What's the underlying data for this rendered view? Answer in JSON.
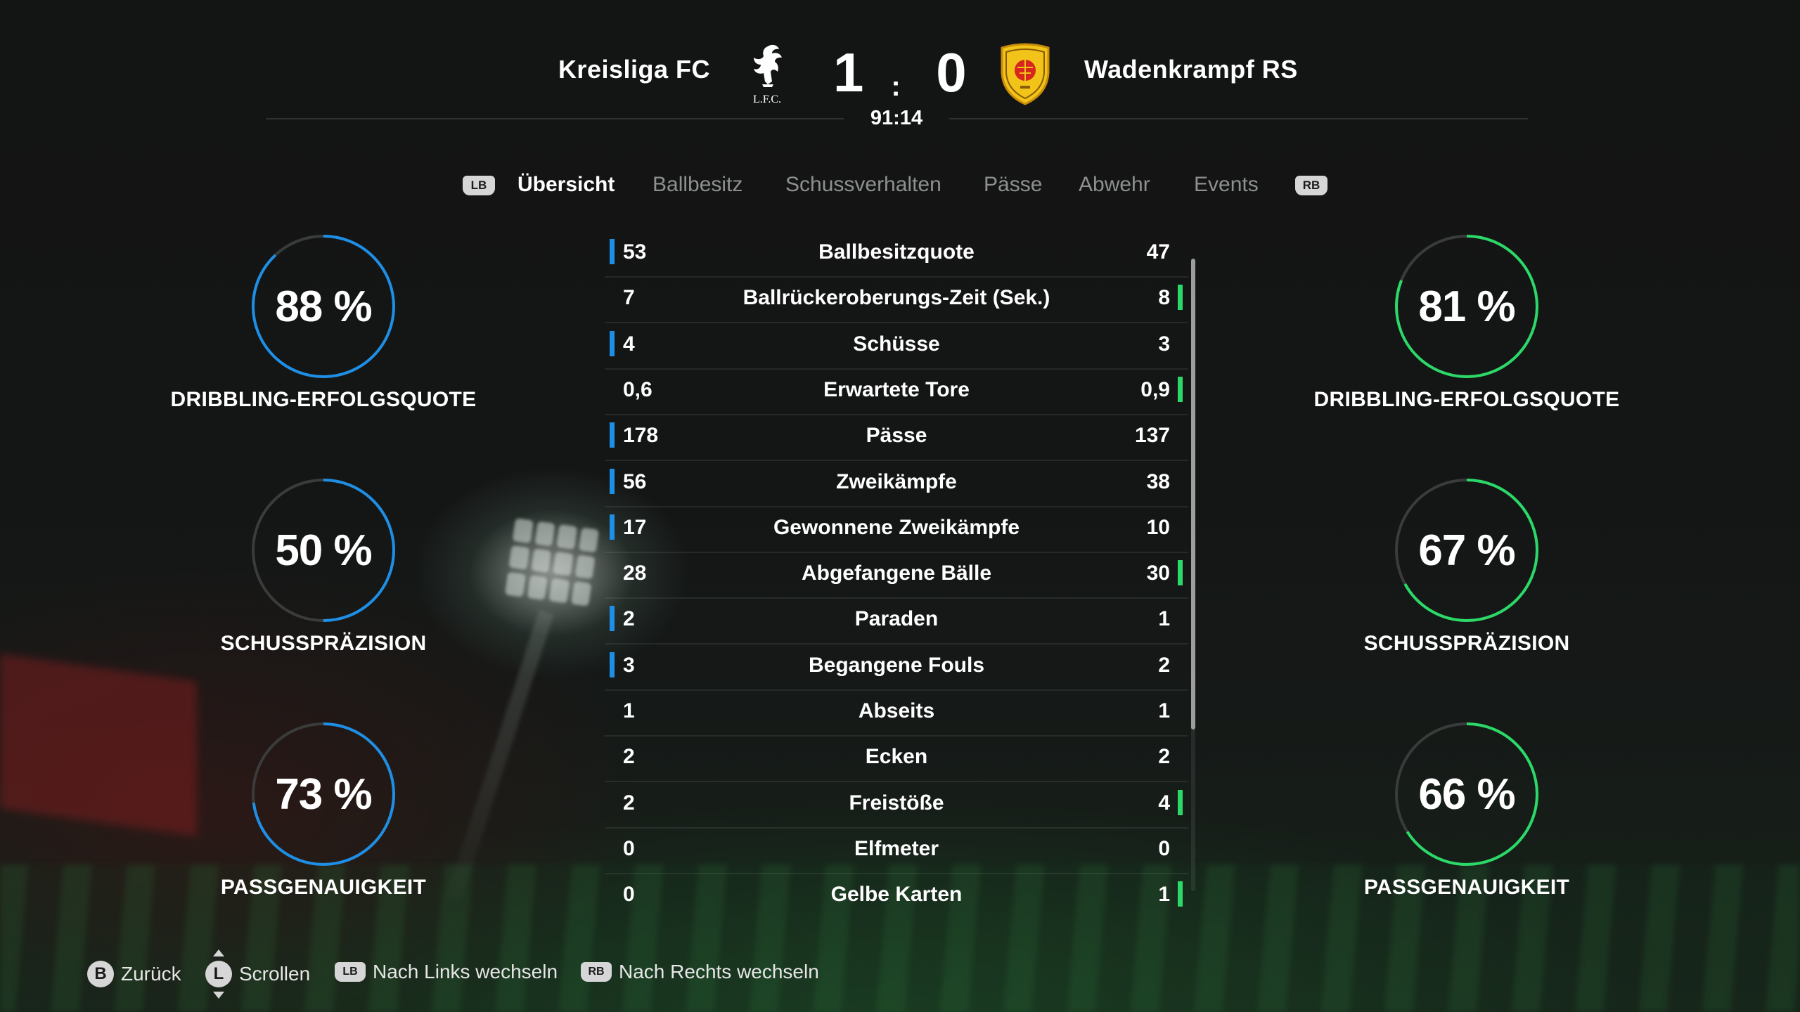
{
  "colors": {
    "home_accent": "#1e8fe6",
    "away_accent": "#2bd968",
    "ring_track": "#3a3c3c"
  },
  "match": {
    "home_team": "Kreisliga FC",
    "away_team": "Wadenkrampf RS",
    "home_score": "1",
    "separator": ":",
    "away_score": "0",
    "clock": "91:14",
    "home_crest_icon": "liverbird-crest-icon",
    "home_crest_text": "L.F.C.",
    "away_crest_icon": "yellow-shield-crest-icon"
  },
  "tabs": {
    "lb": "LB",
    "rb": "RB",
    "items": [
      {
        "label": "Übersicht",
        "active": true
      },
      {
        "label": "Ballbesitz",
        "active": false
      },
      {
        "label": "Schussverhalten",
        "active": false
      },
      {
        "label": "Pässe",
        "active": false
      },
      {
        "label": "Abwehr",
        "active": false
      },
      {
        "label": "Events",
        "active": false
      }
    ]
  },
  "home_rings": [
    {
      "value": "88 %",
      "fraction": 0.88,
      "label": "DRIBBLING-ERFOLGSQUOTE"
    },
    {
      "value": "50 %",
      "fraction": 0.5,
      "label": "SCHUSSPRÄZISION"
    },
    {
      "value": "73 %",
      "fraction": 0.73,
      "label": "PASSGENAUIGKEIT"
    }
  ],
  "away_rings": [
    {
      "value": "81 %",
      "fraction": 0.81,
      "label": "DRIBBLING-ERFOLGSQUOTE"
    },
    {
      "value": "67 %",
      "fraction": 0.67,
      "label": "SCHUSSPRÄZISION"
    },
    {
      "value": "66 %",
      "fraction": 0.66,
      "label": "PASSGENAUIGKEIT"
    }
  ],
  "stats": [
    {
      "label": "Ballbesitzquote",
      "home": "53",
      "away": "47",
      "leader": "home"
    },
    {
      "label": "Ballrückeroberungs-Zeit (Sek.)",
      "home": "7",
      "away": "8",
      "leader": "away"
    },
    {
      "label": "Schüsse",
      "home": "4",
      "away": "3",
      "leader": "home"
    },
    {
      "label": "Erwartete Tore",
      "home": "0,6",
      "away": "0,9",
      "leader": "away"
    },
    {
      "label": "Pässe",
      "home": "178",
      "away": "137",
      "leader": "home"
    },
    {
      "label": "Zweikämpfe",
      "home": "56",
      "away": "38",
      "leader": "home"
    },
    {
      "label": "Gewonnene Zweikämpfe",
      "home": "17",
      "away": "10",
      "leader": "home"
    },
    {
      "label": "Abgefangene Bälle",
      "home": "28",
      "away": "30",
      "leader": "away"
    },
    {
      "label": "Paraden",
      "home": "2",
      "away": "1",
      "leader": "home"
    },
    {
      "label": "Begangene Fouls",
      "home": "3",
      "away": "2",
      "leader": "home"
    },
    {
      "label": "Abseits",
      "home": "1",
      "away": "1",
      "leader": "none"
    },
    {
      "label": "Ecken",
      "home": "2",
      "away": "2",
      "leader": "none"
    },
    {
      "label": "Freistöße",
      "home": "2",
      "away": "4",
      "leader": "away"
    },
    {
      "label": "Elfmeter",
      "home": "0",
      "away": "0",
      "leader": "none"
    },
    {
      "label": "Gelbe Karten",
      "home": "0",
      "away": "1",
      "leader": "away"
    }
  ],
  "footer": {
    "back_button": "B",
    "back_label": "Zurück",
    "scroll_button": "L",
    "scroll_label": "Scrollen",
    "left_button": "LB",
    "left_label": "Nach Links wechseln",
    "right_button": "RB",
    "right_label": "Nach Rechts wechseln"
  }
}
